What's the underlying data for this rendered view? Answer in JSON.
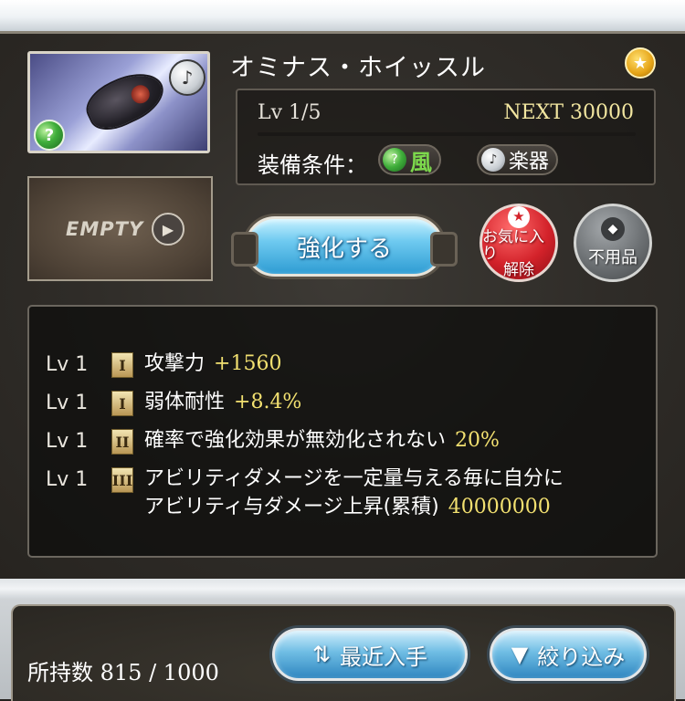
{
  "item": {
    "name": "オミナス・ホイッスル",
    "element_icon": "wind-icon",
    "type_icon": "harp-icon",
    "empty_slot_label": "EMPTY"
  },
  "info": {
    "level_text": "Lv 1/5",
    "next_text": "NEXT 30000",
    "xp_progress": 0,
    "equip_label": "装備条件：",
    "element_label": "風",
    "type_label": "楽器"
  },
  "actions": {
    "enhance_label": "強化する",
    "unfavorite_label_1": "お気に入り",
    "unfavorite_label_2": "解除",
    "unneeded_label": "不用品"
  },
  "skills": [
    {
      "level": "Lv 1",
      "tier": "I",
      "text": "攻撃力",
      "value": "+1560"
    },
    {
      "level": "Lv 1",
      "tier": "I",
      "text": "弱体耐性",
      "value": "+8.4%"
    },
    {
      "level": "Lv 1",
      "tier": "II",
      "text": "確率で強化効果が無効化されない",
      "value": "20%"
    },
    {
      "level": "Lv 1",
      "tier": "III",
      "text_line1": "アビリティダメージを一定量与える毎に自分に",
      "text_line2": "アビリティ与ダメージ上昇(累積)",
      "value": "40000000"
    }
  ],
  "footer": {
    "count_label": "所持数",
    "count_value": "815 / 1000",
    "sort_label": "最近入手",
    "filter_label": "絞り込み"
  },
  "colors": {
    "value_yellow": "#f2e070",
    "wind_green": "#7cd84c",
    "enhance_blue": "#2e9cd3",
    "unfavorite_red": "#d3222a"
  }
}
